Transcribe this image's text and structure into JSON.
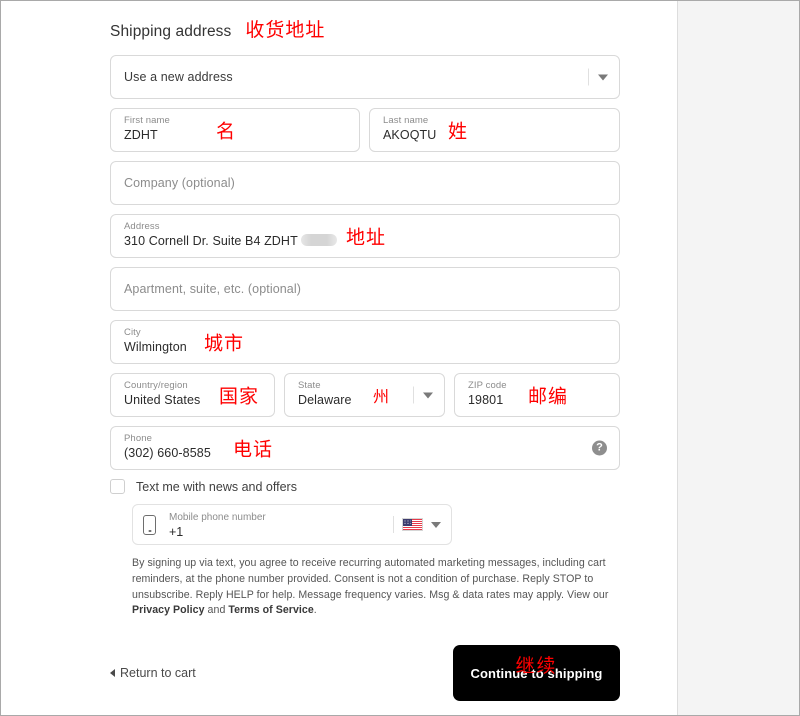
{
  "section": {
    "title": "Shipping address",
    "title_cn": "收货地址"
  },
  "address_select": {
    "value": "Use a new address",
    "chevron_icon": "chevron-down-icon"
  },
  "fields": {
    "first_name": {
      "label": "First name",
      "value": "ZDHT",
      "note_cn": "名"
    },
    "last_name": {
      "label": "Last name",
      "value": "AKOQTU",
      "note_cn": "姓"
    },
    "company": {
      "placeholder": "Company (optional)"
    },
    "address": {
      "label": "Address",
      "value": "310 Cornell Dr. Suite B4 ZDHT",
      "note_cn": "地址",
      "redacted": true
    },
    "apartment": {
      "placeholder": "Apartment, suite, etc. (optional)"
    },
    "city": {
      "label": "City",
      "value": "Wilmington",
      "note_cn": "城市"
    },
    "country": {
      "label": "Country/region",
      "value": "United States",
      "note_cn": "国家"
    },
    "state": {
      "label": "State",
      "value": "Delaware",
      "note_cn": "州",
      "chevron_icon": "chevron-down-icon"
    },
    "zip": {
      "label": "ZIP code",
      "value": "19801",
      "note_cn": "邮编"
    },
    "phone": {
      "label": "Phone",
      "value": "(302) 660-8585",
      "note_cn": "电话",
      "help_icon": "help-circle-icon",
      "help_glyph": "?"
    }
  },
  "sms_optin": {
    "checkbox_label": "Text me with news and offers",
    "checked": false,
    "mobile": {
      "label": "Mobile phone number",
      "value": "+1",
      "phone_icon": "mobile-phone-icon",
      "flag_icon": "us-flag-icon",
      "chevron_icon": "chevron-down-icon"
    },
    "legal_text_1": "By signing up via text, you agree to receive recurring automated marketing messages, including cart reminders, at the phone number provided. Consent is not a condition of purchase. Reply STOP to unsubscribe. Reply HELP for help. Message frequency varies. Msg & data rates may apply. View our ",
    "legal_link_privacy": "Privacy Policy",
    "legal_text_2": " and ",
    "legal_link_terms": "Terms of Service",
    "legal_text_3": "."
  },
  "footer": {
    "back_label": "Return to cart",
    "back_chevron_icon": "chevron-left-icon",
    "cta_label": "Continue to shipping",
    "cta_label_cn": "继续"
  },
  "colors": {
    "accent_annotation": "#ff0000",
    "cta_background": "#000000",
    "field_border": "#d9d9d9",
    "side_panel": "#f4f4f4"
  }
}
